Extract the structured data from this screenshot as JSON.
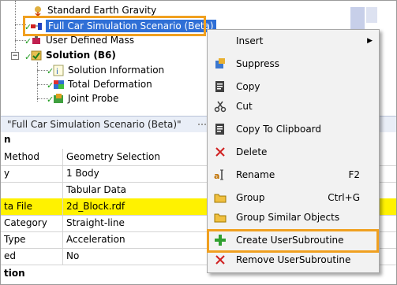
{
  "tree": {
    "items": [
      {
        "label": "Standard Earth Gravity"
      },
      {
        "label": "Full Car Simulation Scenario (Beta)"
      },
      {
        "label": "User Defined Mass"
      },
      {
        "label": "Solution (B6)"
      },
      {
        "label": "Solution Information"
      },
      {
        "label": "Total Deformation"
      },
      {
        "label": "Joint Probe"
      }
    ]
  },
  "details": {
    "header": "\"Full Car Simulation Scenario (Beta)\"",
    "group1": "n",
    "rows": [
      {
        "label": "Method",
        "value": "Geometry Selection"
      },
      {
        "label": "y",
        "value": "1 Body"
      },
      {
        "label": "",
        "value": "Tabular Data"
      },
      {
        "label": "ta File",
        "value": "2d_Block.rdf"
      },
      {
        "label": "Category",
        "value": "Straight-line"
      },
      {
        "label": "Type",
        "value": "Acceleration"
      },
      {
        "label": "ed",
        "value": "No"
      }
    ],
    "group2": "tion"
  },
  "menu": {
    "items": [
      {
        "label": "Insert",
        "shortcut": "",
        "icon": "none",
        "arrow": "▶"
      },
      {
        "label": "Suppress",
        "shortcut": "",
        "icon": "suppress-icon"
      },
      {
        "label": "Copy",
        "shortcut": "",
        "icon": "copy-icon"
      },
      {
        "label": "Cut",
        "shortcut": "",
        "icon": "cut-icon"
      },
      {
        "label": "Copy To Clipboard",
        "shortcut": "",
        "icon": "clipboard-icon"
      },
      {
        "label": "Delete",
        "shortcut": "",
        "icon": "delete-icon"
      },
      {
        "label": "Rename",
        "shortcut": "F2",
        "icon": "rename-icon"
      },
      {
        "label": "Group",
        "shortcut": "Ctrl+G",
        "icon": "folder-icon"
      },
      {
        "label": "Group Similar Objects",
        "shortcut": "",
        "icon": "folder-icon"
      },
      {
        "label": "Create UserSubroutine",
        "shortcut": "",
        "icon": "plus-icon"
      },
      {
        "label": "Remove UserSubroutine",
        "shortcut": "",
        "icon": "delete-icon"
      }
    ]
  },
  "colors": {
    "highlight": "#f0a020",
    "selection": "#2f6fd6",
    "yellow_row": "#fff200"
  }
}
